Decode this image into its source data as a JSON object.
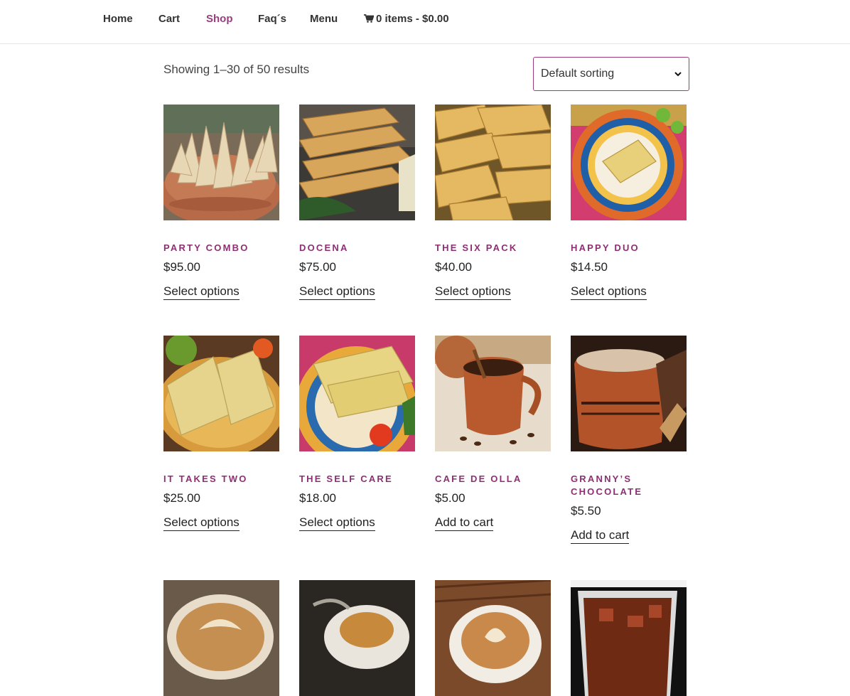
{
  "nav": {
    "items": [
      {
        "label": "Home"
      },
      {
        "label": "Cart"
      },
      {
        "label": "Shop"
      },
      {
        "label": "Faq´s"
      },
      {
        "label": "Menu"
      }
    ],
    "cart_summary": "0 items - $0.00",
    "active_color": "#9b3c7e"
  },
  "toolbar": {
    "result_count": "Showing 1–30 of 50 results",
    "ordering": {
      "selected": "Default sorting"
    }
  },
  "products": [
    {
      "title": "PARTY COMBO",
      "price": "$95.00",
      "action": "Select options",
      "image": "tamales-basket"
    },
    {
      "title": "DOCENA",
      "price": "$75.00",
      "action": "Select options",
      "image": "tamales-stack"
    },
    {
      "title": "THE SIX PACK",
      "price": "$40.00",
      "action": "Select options",
      "image": "tamales-pile"
    },
    {
      "title": "HAPPY DUO",
      "price": "$14.50",
      "action": "Select options",
      "image": "tamales-plate"
    },
    {
      "title": "IT TAKES TWO",
      "price": "$25.00",
      "action": "Select options",
      "image": "tamales-two"
    },
    {
      "title": "THE SELF CARE",
      "price": "$18.00",
      "action": "Select options",
      "image": "tamal-plate"
    },
    {
      "title": "CAFE DE OLLA",
      "price": "$5.00",
      "action": "Add to cart",
      "image": "clay-mug-coffee"
    },
    {
      "title": "GRANNY’S CHOCOLATE",
      "price": "$5.50",
      "action": "Add to cart",
      "image": "clay-mug-chocolate"
    },
    {
      "title": "",
      "price": "",
      "action": "",
      "image": "latte-cup"
    },
    {
      "title": "",
      "price": "",
      "action": "",
      "image": "espresso-cup"
    },
    {
      "title": "",
      "price": "",
      "action": "",
      "image": "cappuccino-cup"
    },
    {
      "title": "",
      "price": "",
      "action": "",
      "image": "iced-coffee-cup"
    }
  ]
}
